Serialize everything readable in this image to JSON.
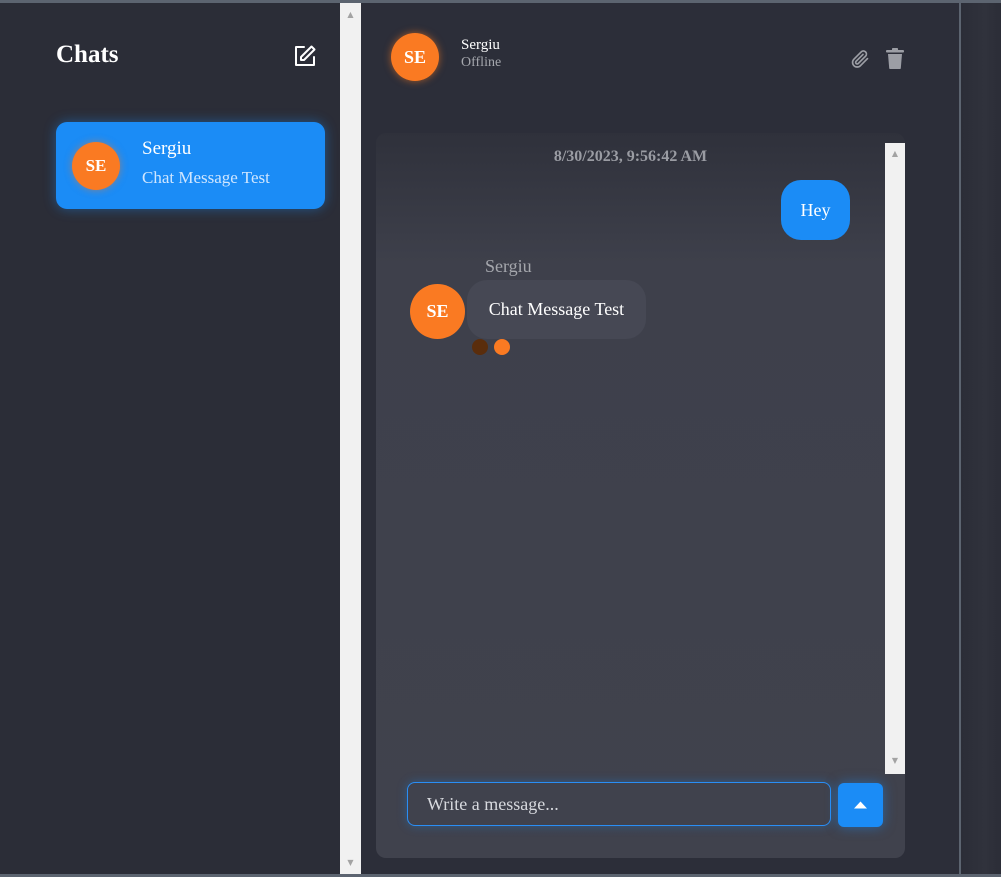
{
  "sidebar": {
    "title": "Chats",
    "chats": [
      {
        "initials": "SE",
        "name": "Sergiu",
        "preview": "Chat Message Test"
      }
    ]
  },
  "header": {
    "initials": "SE",
    "name": "Sergiu",
    "status": "Offline"
  },
  "messages": {
    "timestamp": "8/30/2023, 9:56:42 AM",
    "outgoing": [
      {
        "text": "Hey"
      }
    ],
    "incoming": [
      {
        "sender": "Sergiu",
        "initials": "SE",
        "text": "Chat Message Test"
      }
    ]
  },
  "composer": {
    "placeholder": "Write a message..."
  },
  "icons": {
    "compose": "edit-icon",
    "attach": "paperclip-icon",
    "delete": "trash-icon",
    "send": "caret-up-icon",
    "scroll_up": "scroll-up-arrow-icon",
    "scroll_down": "scroll-down-arrow-icon"
  },
  "colors": {
    "accent": "#1b8cf6",
    "avatar": "#fa7a22",
    "background": "#2b2d37",
    "panel": "#40424d",
    "reaction_dark": "#5a2d0c",
    "reaction_light": "#fa7a22"
  }
}
